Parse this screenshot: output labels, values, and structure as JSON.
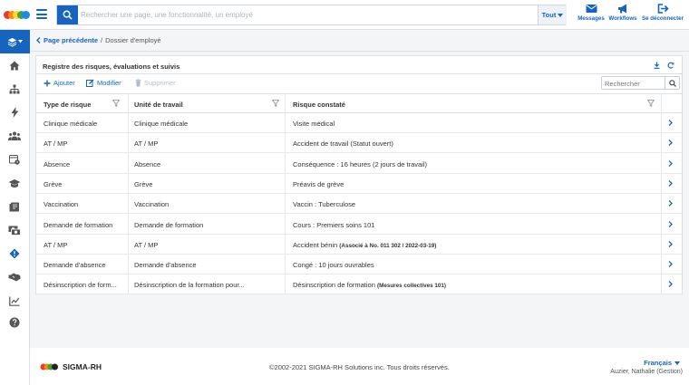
{
  "colors": {
    "primary": "#1565c0",
    "logo": [
      "#e53935",
      "#fb8c00",
      "#fdd835",
      "#43a047",
      "#1e88e5"
    ]
  },
  "search": {
    "placeholder": "Rechercher une page, une fonctionnalité, un employé",
    "scope": "Tout"
  },
  "top_actions": [
    {
      "label": "Messages",
      "icon": "envelope-icon"
    },
    {
      "label": "Workflows",
      "icon": "megaphone-icon"
    },
    {
      "label": "Se déconnecter",
      "icon": "logout-icon"
    }
  ],
  "sidebar": {
    "icons": [
      "layers-icon",
      "home-icon",
      "org-chart-icon",
      "bolt-icon",
      "people-icon",
      "calendar-icon",
      "graduation-cap-icon",
      "book-icon",
      "money-icon",
      "risk-diamond-icon",
      "handshake-icon",
      "chart-icon",
      "help-icon"
    ]
  },
  "breadcrumb": {
    "back": "Page précédente",
    "separator": "/",
    "current": "Dossier d'employé"
  },
  "panel": {
    "title": "Registre des risques, évaluations et suivis",
    "toolbar": {
      "add": "Ajouter",
      "edit": "Modifier",
      "delete": "Supprimer"
    },
    "search_placeholder": "Rechercher",
    "columns": [
      "Type de risque",
      "Unité de travail",
      "Risque constaté"
    ],
    "rows": [
      {
        "type": "Clinique médicale",
        "unit": "Clinique médicale",
        "risk": "Visite médical",
        "note": ""
      },
      {
        "type": "AT / MP",
        "unit": "AT / MP",
        "risk": "Accident de travail (Statut ouvert)",
        "note": ""
      },
      {
        "type": "Absence",
        "unit": "Absence",
        "risk": "Conséquence : 16 heures (2 jours de travail)",
        "note": ""
      },
      {
        "type": "Grève",
        "unit": "Grève",
        "risk": "Préavis de grève",
        "note": ""
      },
      {
        "type": "Vaccination",
        "unit": "Vaccination",
        "risk": "Vaccin : Tuberculose",
        "note": ""
      },
      {
        "type": "Demande de formation",
        "unit": "Demande de formation",
        "risk": "Cours : Premiers soins 101",
        "note": ""
      },
      {
        "type": "AT / MP",
        "unit": "AT / MP",
        "risk": "Accident bénin",
        "note": "(Associé à No. 011 302 / 2022-03-19)"
      },
      {
        "type": "Demande d'absence",
        "unit": "Demande d'absence",
        "risk": "Congé : 10 jours ouvrables",
        "note": ""
      },
      {
        "type": "Désinscription de form...",
        "unit": "Désinscription de la formation pour...",
        "risk": "Désinscription de formation",
        "note": "(Mesures collectives 101)"
      }
    ]
  },
  "footer": {
    "brand": "SIGMA-RH",
    "copyright": "©2002-2021 SIGMA-RH Solutions inc. Tous droits réservés.",
    "language": "Français",
    "user": "Auzier, Nathalie (Gestion)"
  }
}
